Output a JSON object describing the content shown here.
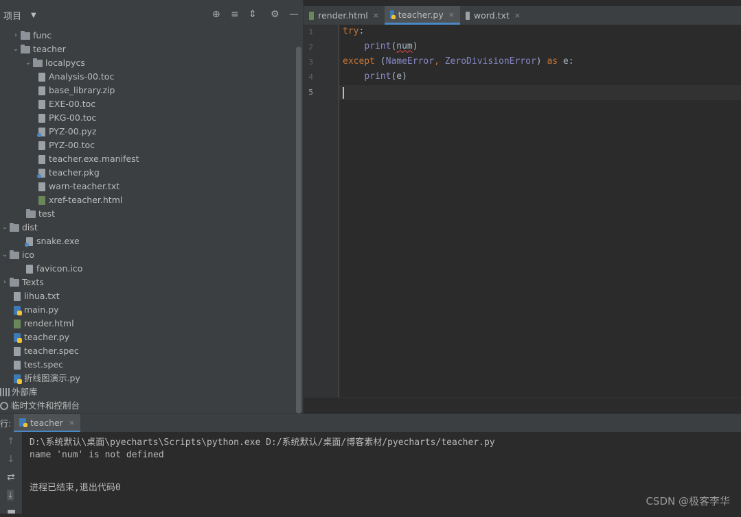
{
  "project": {
    "title": "项目",
    "dropdown": "▼",
    "icons": [
      "target-icon",
      "expand-icon",
      "collapse-icon",
      "gear-icon",
      "minimize-icon"
    ]
  },
  "tree": [
    {
      "label": "func",
      "kind": "folder",
      "arrow": "›",
      "depth": 1
    },
    {
      "label": "teacher",
      "kind": "folder",
      "arrow": "⌄",
      "depth": 1
    },
    {
      "label": "localpycs",
      "kind": "folder",
      "arrow": "⌄",
      "depth": 2
    },
    {
      "label": "Analysis-00.toc",
      "kind": "file",
      "depth": 3
    },
    {
      "label": "base_library.zip",
      "kind": "file",
      "depth": 3
    },
    {
      "label": "EXE-00.toc",
      "kind": "file",
      "depth": 3
    },
    {
      "label": "PKG-00.toc",
      "kind": "file",
      "depth": 3
    },
    {
      "label": "PYZ-00.pyz",
      "kind": "file-gen",
      "depth": 3
    },
    {
      "label": "PYZ-00.toc",
      "kind": "file",
      "depth": 3
    },
    {
      "label": "teacher.exe.manifest",
      "kind": "file",
      "depth": 3
    },
    {
      "label": "teacher.pkg",
      "kind": "file-gen",
      "depth": 3
    },
    {
      "label": "warn-teacher.txt",
      "kind": "file",
      "depth": 3
    },
    {
      "label": "xref-teacher.html",
      "kind": "file-html",
      "depth": 3
    },
    {
      "label": "test",
      "kind": "folder",
      "depth": 2
    },
    {
      "label": "dist",
      "kind": "folder",
      "arrow": "⌄",
      "depth": 0
    },
    {
      "label": "snake.exe",
      "kind": "file-gen",
      "depth": 2
    },
    {
      "label": "ico",
      "kind": "folder",
      "arrow": "⌄",
      "depth": 0
    },
    {
      "label": "favicon.ico",
      "kind": "file",
      "depth": 2
    },
    {
      "label": "Texts",
      "kind": "folder",
      "arrow": "›",
      "depth": 0
    },
    {
      "label": "lihua.txt",
      "kind": "file",
      "depth": 1
    },
    {
      "label": "main.py",
      "kind": "file-py",
      "depth": 1
    },
    {
      "label": "render.html",
      "kind": "file-html",
      "depth": 1
    },
    {
      "label": "teacher.py",
      "kind": "file-py",
      "depth": 1
    },
    {
      "label": "teacher.spec",
      "kind": "file",
      "depth": 1
    },
    {
      "label": "test.spec",
      "kind": "file",
      "depth": 1
    },
    {
      "label": "折线图演示.py",
      "kind": "file-py",
      "depth": 1
    },
    {
      "label": "外部库",
      "kind": "lib",
      "depth": 0
    },
    {
      "label": "临时文件和控制台",
      "kind": "scratch",
      "depth": 0
    }
  ],
  "tabs": [
    {
      "label": "render.html",
      "icon": "html-file-icon",
      "close": "×",
      "active": false
    },
    {
      "label": "teacher.py",
      "icon": "python-file-icon",
      "close": "×",
      "active": true
    },
    {
      "label": "word.txt",
      "icon": "text-file-icon",
      "close": "×",
      "active": false
    }
  ],
  "editor": {
    "line_numbers": [
      "1",
      "2",
      "3",
      "4",
      "5"
    ],
    "code": {
      "l1_kw": "try",
      "l1_rest": ":",
      "l2_indent": "    ",
      "l2_fn": "print",
      "l2_open": "(",
      "l2_arg": "num",
      "l2_close": ")",
      "l3_kw": "except",
      "l3_a": " (",
      "l3_b": "NameError",
      "l3_c": ", ",
      "l3_d": "ZeroDivisionError",
      "l3_e": ") ",
      "l3_as": "as",
      "l3_f": " e:",
      "l4_indent": "    ",
      "l4_fn": "print",
      "l4_rest": "(e)"
    }
  },
  "run": {
    "label": "行:",
    "tab_label": "teacher",
    "tab_close": "×",
    "console": [
      "D:\\系统默认\\桌面\\pyecharts\\Scripts\\python.exe D:/系统默认/桌面/博客素材/pyecharts/teacher.py",
      "name 'num' is not defined",
      "",
      "进程已结束,退出代码0"
    ],
    "side_icons": [
      "arrow-up-icon",
      "arrow-down-icon",
      "soft-wrap-icon",
      "scroll-to-end-icon",
      "print-icon"
    ]
  },
  "watermark": "CSDN @极客李华"
}
